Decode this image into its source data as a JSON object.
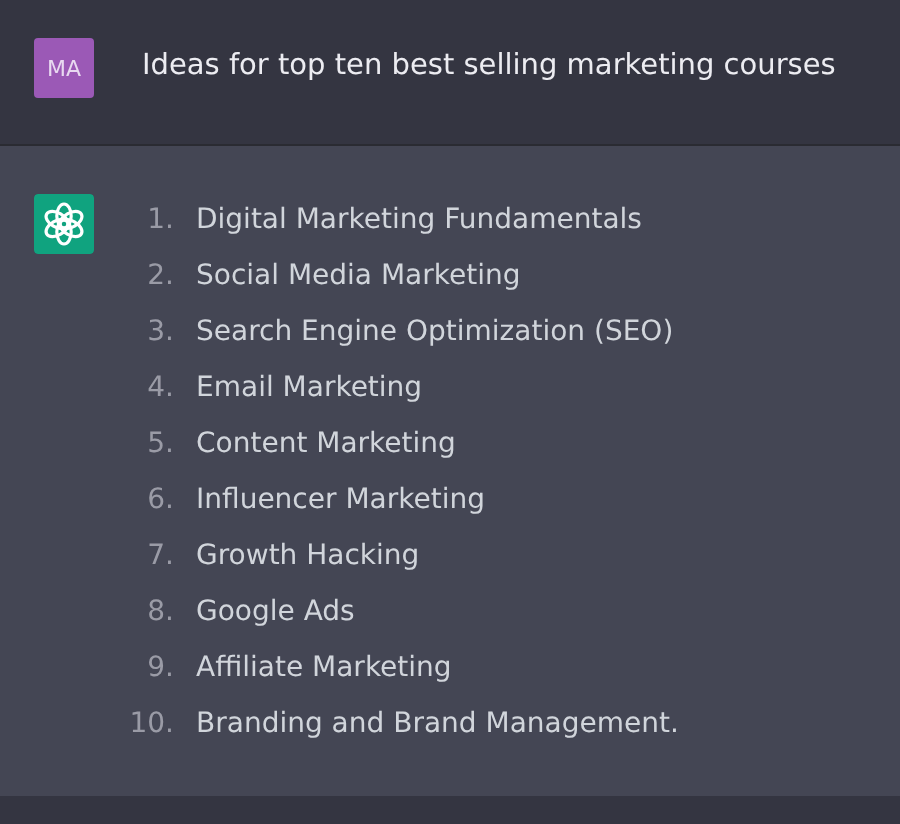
{
  "prompt": {
    "avatar": "MA",
    "text": "Ideas for top ten best selling marketing courses"
  },
  "response": {
    "items": [
      {
        "number": "1.",
        "text": "Digital Marketing Fundamentals"
      },
      {
        "number": "2.",
        "text": "Social Media Marketing"
      },
      {
        "number": "3.",
        "text": "Search Engine Optimization (SEO)"
      },
      {
        "number": "4.",
        "text": "Email Marketing"
      },
      {
        "number": "5.",
        "text": "Content Marketing"
      },
      {
        "number": "6.",
        "text": "Influencer Marketing"
      },
      {
        "number": "7.",
        "text": "Growth Hacking"
      },
      {
        "number": "8.",
        "text": "Google Ads"
      },
      {
        "number": "9.",
        "text": "Affiliate Marketing"
      },
      {
        "number": "10.",
        "text": "Branding and Brand Management."
      }
    ]
  }
}
